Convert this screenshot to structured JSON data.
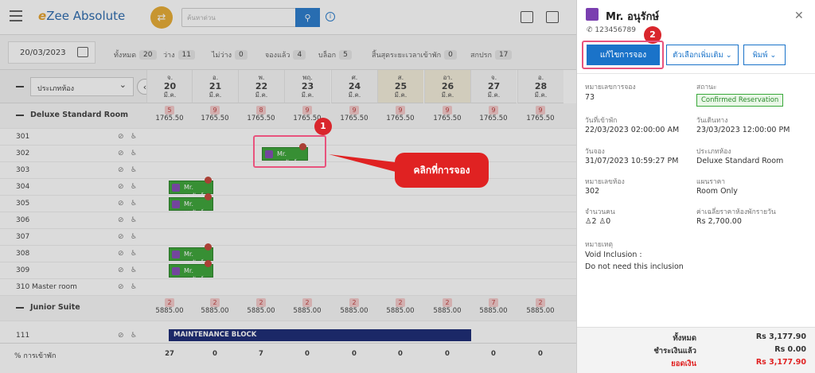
{
  "app": {
    "logo_e": "e",
    "logo_rest": "Zee Absolute",
    "search_placeholder": "ค้นหาด่วน"
  },
  "filters": {
    "date": "20/03/2023",
    "stats": [
      {
        "label": "ทั้งหมด",
        "count": "20"
      },
      {
        "label": "ว่าง",
        "count": "11"
      },
      {
        "label": "ไม่ว่าง",
        "count": "0"
      },
      {
        "label": "จองแล้ว",
        "count": "4"
      },
      {
        "label": "บล็อก",
        "count": "5"
      },
      {
        "label": "สิ้นสุดระยะเวลาเข้าพัก",
        "count": "0"
      },
      {
        "label": "สกปรก",
        "count": "17"
      }
    ]
  },
  "grid": {
    "room_type_select": "ประเภทห้อง",
    "days": [
      {
        "dow": "จ.",
        "num": "20",
        "mon": "มี.ค."
      },
      {
        "dow": "อ.",
        "num": "21",
        "mon": "มี.ค."
      },
      {
        "dow": "พ.",
        "num": "22",
        "mon": "มี.ค."
      },
      {
        "dow": "พฤ.",
        "num": "23",
        "mon": "มี.ค."
      },
      {
        "dow": "ศ.",
        "num": "24",
        "mon": "มี.ค."
      },
      {
        "dow": "ส.",
        "num": "25",
        "mon": "มี.ค."
      },
      {
        "dow": "อา.",
        "num": "26",
        "mon": "มี.ค."
      },
      {
        "dow": "จ.",
        "num": "27",
        "mon": "มี.ค."
      },
      {
        "dow": "อ.",
        "num": "28",
        "mon": "มี.ค."
      }
    ],
    "deluxe": {
      "name": "Deluxe Standard Room",
      "avail": [
        "5",
        "9",
        "8",
        "9",
        "9",
        "9",
        "9",
        "9",
        "9"
      ],
      "rate": "1765.50",
      "rooms": [
        "301",
        "302",
        "303",
        "304",
        "305",
        "306",
        "307",
        "308",
        "309",
        "310 Master room"
      ]
    },
    "junior": {
      "name": "Junior Suite",
      "avail": [
        "2",
        "2",
        "2",
        "2",
        "2",
        "2",
        "2",
        "7",
        "2"
      ],
      "rate": "5885.00",
      "rooms": [
        "111"
      ]
    },
    "reservation_label": "Mr. อนุรักษ์",
    "maintenance": "MAINTENANCE BLOCK",
    "occupancy_label": "% การเข้าพัก",
    "occupancy": [
      "27",
      "0",
      "7",
      "0",
      "0",
      "0",
      "0",
      "0",
      "0"
    ]
  },
  "annotations": {
    "marker1": "1",
    "marker2": "2",
    "callout": "คลิกที่การจอง"
  },
  "panel": {
    "guest_name": "Mr. อนุรักษ์",
    "phone": "123456789",
    "edit_button": "แก้ไขการจอง",
    "more_options": "ตัวเลือกเพิ่มเติม",
    "print": "พิมพ์",
    "fields": {
      "booking_no_label": "หมายเลขการจอง",
      "booking_no": "73",
      "status_label": "สถานะ",
      "status": "Confirmed Reservation",
      "checkin_label": "วันที่เข้าพัก",
      "checkin": "22/03/2023 02:00:00 AM",
      "checkout_label": "วันเดินทาง",
      "checkout": "23/03/2023 12:00:00 PM",
      "booked_label": "วันจอง",
      "booked": "31/07/2023 10:59:27 PM",
      "roomtype_label": "ประเภทห้อง",
      "roomtype": "Deluxe Standard Room",
      "roomno_label": "หมายเลขห้อง",
      "roomno": "302",
      "plan_label": "แผนราคา",
      "plan": "Room Only",
      "pax_label": "จำนวนคน",
      "adults": "2",
      "children": "0",
      "avg_label": "ค่าเฉลี่ยราคาห้องพักรายวัน",
      "avg": "Rs 2,700.00",
      "note_label": "หมายเหตุ",
      "note_line1": "Void Inclusion :",
      "note_line2": "Do not need this inclusion"
    },
    "totals": {
      "total_label": "ทั้งหมด",
      "total": "Rs 3,177.90",
      "paid_label": "ชำระเงินแล้ว",
      "paid": "Rs 0.00",
      "balance_label": "ยอดเงิน",
      "balance": "Rs 3,177.90"
    }
  },
  "colors": {
    "accent": "#1a73c9",
    "reservation": "#2e9e2a",
    "maintenance": "#0a1a6b",
    "highlight": "#e8537d",
    "callout": "#e02222"
  }
}
